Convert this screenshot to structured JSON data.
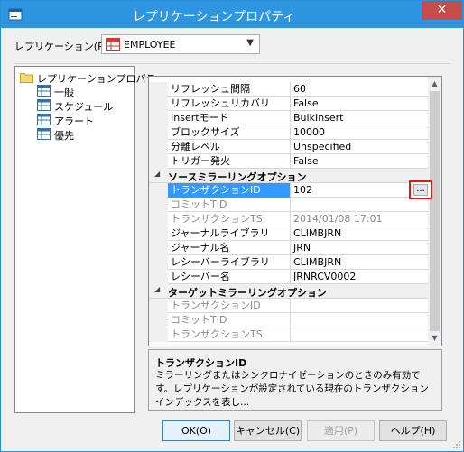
{
  "window": {
    "title": "レプリケーションプロパティ",
    "close_glyph": "✕"
  },
  "replication": {
    "label": "レプリケーション(R)",
    "selected": "EMPLOYEE"
  },
  "tree": {
    "root": "レプリケーションプロパティ",
    "items": [
      "一般",
      "スケジュール",
      "アラート",
      "優先"
    ]
  },
  "grid": {
    "top_rows": [
      {
        "name": "リフレッシュ間隔",
        "value": "60"
      },
      {
        "name": "リフレッシュリカバリ",
        "value": "False"
      },
      {
        "name": "Insertモード",
        "value": "BulkInsert"
      },
      {
        "name": "ブロックサイズ",
        "value": "10000"
      },
      {
        "name": "分離レベル",
        "value": "Unspecified"
      },
      {
        "name": "トリガー発火",
        "value": "False"
      }
    ],
    "source_category": "ソースミラーリングオプション",
    "source_rows": [
      {
        "name": "トランザクションID",
        "value": "102",
        "selected": true,
        "disabled": false
      },
      {
        "name": "コミットTID",
        "value": "",
        "selected": false,
        "disabled": true
      },
      {
        "name": "トランザクションTS",
        "value": "2014/01/08 17:01",
        "selected": false,
        "disabled": true
      },
      {
        "name": "ジャーナルライブラリ",
        "value": "CLIMBJRN",
        "selected": false,
        "disabled": false
      },
      {
        "name": "ジャーナル名",
        "value": "JRN",
        "selected": false,
        "disabled": false
      },
      {
        "name": "レシーバーライブラリ",
        "value": "CLIMBJRN",
        "selected": false,
        "disabled": false
      },
      {
        "name": "レシーバー名",
        "value": "JRNRCV0002",
        "selected": false,
        "disabled": false
      }
    ],
    "target_category": "ターゲットミラーリングオプション",
    "target_rows": [
      {
        "name": "トランザクションID",
        "value": ""
      },
      {
        "name": "コミットTID",
        "value": ""
      },
      {
        "name": "トランザクションTS",
        "value": ""
      }
    ],
    "ellipsis_label": "..."
  },
  "help": {
    "title": "トランザクションID",
    "description": "ミラーリングまたはシンクロナイゼーションのときのみ有効です。レプリケーションが設定されている現在のトランザクションインデックスを表し..."
  },
  "buttons": {
    "ok": "OK(O)",
    "cancel": "キャンセル(C)",
    "apply": "適用(P)",
    "help": "ヘルプ(H)"
  },
  "colors": {
    "titlebar": "#2e96e0",
    "selection": "#3399ff",
    "highlight_box": "#e0161e"
  }
}
